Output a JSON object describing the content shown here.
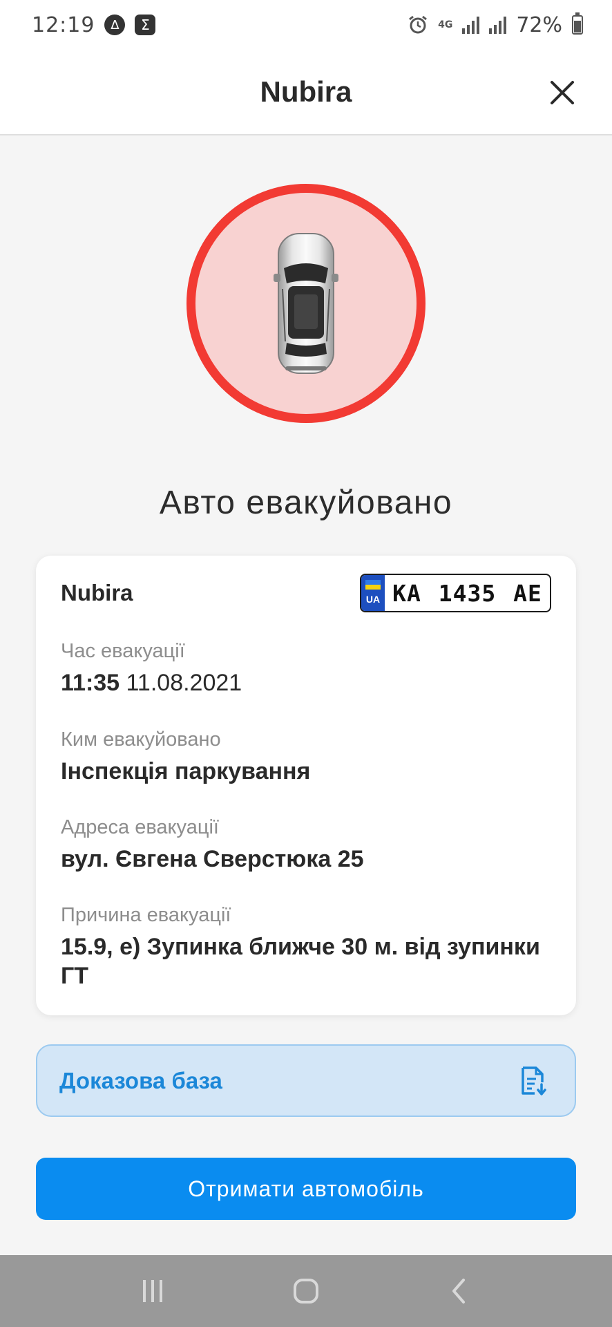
{
  "status_bar": {
    "time": "12:19",
    "notif_icon_1": "Δ",
    "notif_icon_2": "Σ",
    "network": "4G",
    "battery": "72%"
  },
  "header": {
    "title": "Nubira"
  },
  "status": {
    "headline": "Авто евакуйовано",
    "color": "#f23a33"
  },
  "details": {
    "car_name": "Nubira",
    "plate": {
      "country": "UA",
      "number": "KA 1435 AE"
    },
    "fields": [
      {
        "label": "Час евакуації",
        "time": "11:35",
        "date": "11.08.2021"
      },
      {
        "label": "Ким евакуйовано",
        "value": "Інспекція паркування"
      },
      {
        "label": "Адреса евакуації",
        "value": "вул. Євгена Сверстюка 25"
      },
      {
        "label": "Причина евакуації",
        "value": "15.9, е) Зупинка ближче 30 м. від зупинки ГТ"
      }
    ]
  },
  "evidence": {
    "label": "Доказова база",
    "icon": "document-download-icon"
  },
  "action": {
    "label": "Отримати автомобіль",
    "color": "#0a8cf0"
  },
  "nav": {
    "icons": [
      "recent-apps-icon",
      "home-icon",
      "back-icon"
    ]
  }
}
